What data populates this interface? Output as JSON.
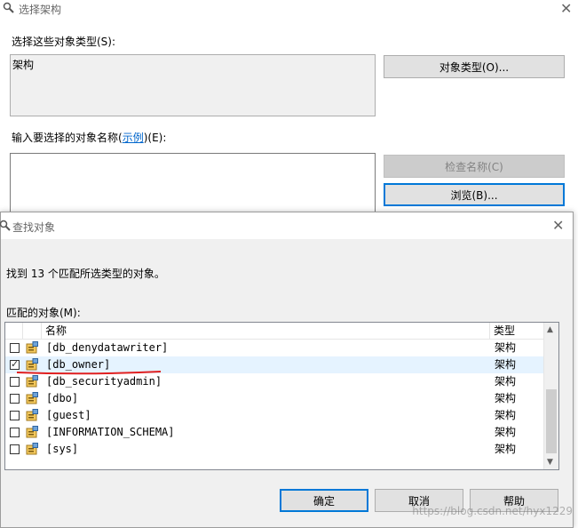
{
  "back_dialog": {
    "title": "选择架构",
    "object_types_label": "选择这些对象类型(S):",
    "object_types_value": "架构",
    "object_types_button": "对象类型(O)...",
    "enter_names_label_pre": "输入要选择的对象名称(",
    "enter_names_link": "示例",
    "enter_names_label_post": ")(E):",
    "check_names_button": "检查名称(C)",
    "browse_button": "浏览(B)..."
  },
  "find_dialog": {
    "title": "查找对象",
    "found_text": "找到 13 个匹配所选类型的对象。",
    "matching_label": "匹配的对象(M):",
    "columns": {
      "name": "名称",
      "type": "类型"
    },
    "rows": [
      {
        "name": "[db_denydatawriter]",
        "type": "架构",
        "checked": false
      },
      {
        "name": "[db_owner]",
        "type": "架构",
        "checked": true
      },
      {
        "name": "[db_securityadmin]",
        "type": "架构",
        "checked": false
      },
      {
        "name": "[dbo]",
        "type": "架构",
        "checked": false
      },
      {
        "name": "[guest]",
        "type": "架构",
        "checked": false
      },
      {
        "name": "[INFORMATION_SCHEMA]",
        "type": "架构",
        "checked": false
      },
      {
        "name": "[sys]",
        "type": "架构",
        "checked": false
      }
    ],
    "ok_button": "确定",
    "cancel_button": "取消",
    "help_button": "帮助"
  },
  "watermark": "https://blog.csdn.net/hyx1229",
  "colors": {
    "accent": "#0078d7",
    "selection": "#e5f3ff",
    "annotation": "#e02020"
  },
  "icons": {
    "title": "search-icon",
    "row": "schema-icon",
    "close": "close-icon"
  }
}
